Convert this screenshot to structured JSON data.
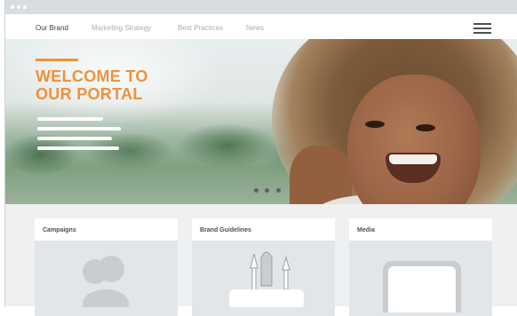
{
  "nav": {
    "links": [
      "Our Brand",
      "Marketing Strategy",
      "Best Practices",
      "News"
    ],
    "active_index": 0
  },
  "hero": {
    "title_line1": "WELCOME TO",
    "title_line2": "OUR PORTAL",
    "slides_total": 3,
    "active_slide": 1
  },
  "cards": [
    {
      "title": "Campaigns",
      "icon": "users-icon"
    },
    {
      "title": "Brand Guidelines",
      "icon": "pencil-cup-icon"
    },
    {
      "title": "Media",
      "icon": "tablet-icon"
    }
  ],
  "colors": {
    "accent": "#f0913a",
    "nav_active": "#3c4247",
    "nav_inactive": "#a9aeb2",
    "card_body": "#e3e6e8",
    "icon_gray": "#c9cdd0"
  }
}
